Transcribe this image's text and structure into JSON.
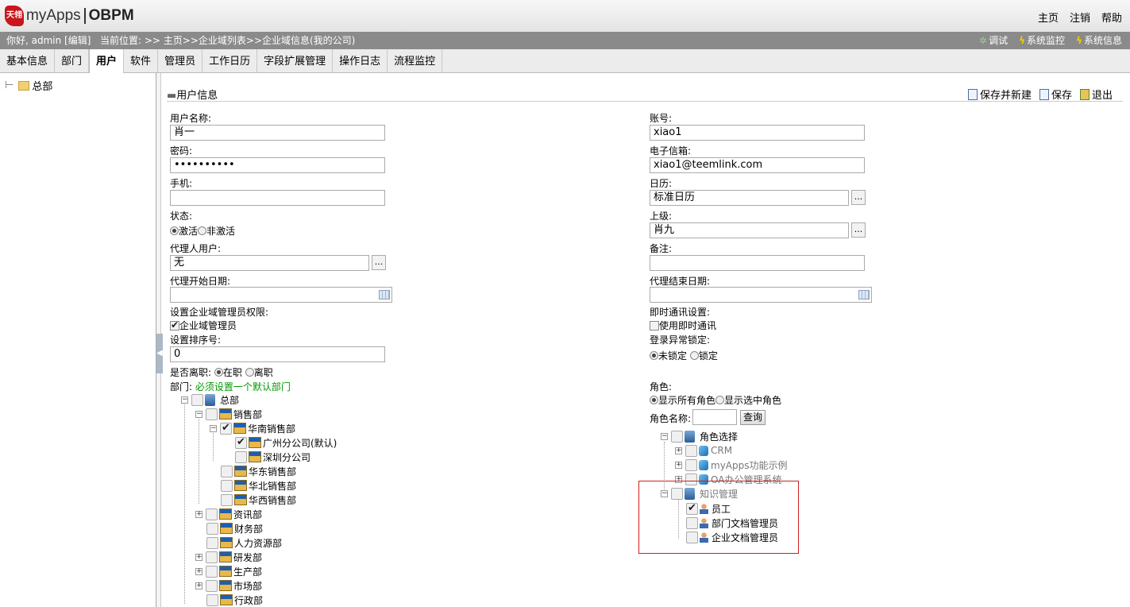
{
  "header": {
    "logo_mark": "天翎",
    "app_name": "myApps",
    "product": "OBPM",
    "links": [
      "主页",
      "注销",
      "帮助"
    ]
  },
  "statusbar": {
    "greeting": "你好, admin [编辑]",
    "location": "当前位置: >> 主页>>企业域列表>>企业域信息(我的公司)",
    "right": [
      "调试",
      "系统监控",
      "系统信息"
    ]
  },
  "tabs": [
    "基本信息",
    "部门",
    "用户",
    "软件",
    "管理员",
    "工作日历",
    "字段扩展管理",
    "操作日志",
    "流程监控"
  ],
  "left_tree": {
    "root": "总部"
  },
  "section": {
    "title": "用户信息"
  },
  "actions": [
    "保存并新建",
    "保存",
    "退出"
  ],
  "form": {
    "username_label": "用户名称:",
    "username": "肖一",
    "account_label": "账号:",
    "account": "xiao1",
    "password_label": "密码:",
    "password": "••••••••••",
    "email_label": "电子信箱:",
    "email": "xiao1@teemlink.com",
    "mobile_label": "手机:",
    "mobile": "",
    "calendar_label": "日历:",
    "calendar": "标准日历",
    "status_label": "状态:",
    "status_active": "激活",
    "status_inactive": "非激活",
    "superior_label": "上级:",
    "superior": "肖九",
    "proxy_label": "代理人用户:",
    "proxy": "无",
    "remark_label": "备注:",
    "proxy_start_label": "代理开始日期:",
    "proxy_end_label": "代理结束日期:",
    "admin_perm_label": "设置企业域管理员权限:",
    "admin_perm_option": "企业域管理员",
    "im_label": "即时通讯设置:",
    "im_option": "使用即时通讯",
    "sort_label": "设置排序号:",
    "sort": "0",
    "lock_label": "登录异常锁定:",
    "lock_unlocked": "未锁定",
    "lock_locked": "锁定",
    "resign_label": "是否离职:",
    "resign_on": "在职",
    "resign_off": "离职",
    "dept_label": "部门:",
    "dept_hint": "必须设置一个默认部门",
    "role_label": "角色:",
    "role_show_all": "显示所有角色",
    "role_show_selected": "显示选中角色",
    "role_name_label": "角色名称:",
    "query_button": "查询"
  },
  "dept_tree": {
    "root": "总部",
    "sales": "销售部",
    "south": "华南销售部",
    "guangzhou": "广州分公司(默认)",
    "shenzhen": "深圳分公司",
    "east": "华东销售部",
    "north": "华北销售部",
    "west": "华西销售部",
    "info": "资讯部",
    "finance": "财务部",
    "hr": "人力资源部",
    "rd": "研发部",
    "production": "生产部",
    "market": "市场部",
    "admin": "行政部"
  },
  "role_tree": {
    "root": "角色选择",
    "crm": "CRM",
    "myapps": "myApps功能示例",
    "oa": "OA办公管理系统",
    "km": "知识管理",
    "employee": "员工",
    "dept_doc_admin": "部门文档管理员",
    "corp_doc_admin": "企业文档管理员"
  }
}
